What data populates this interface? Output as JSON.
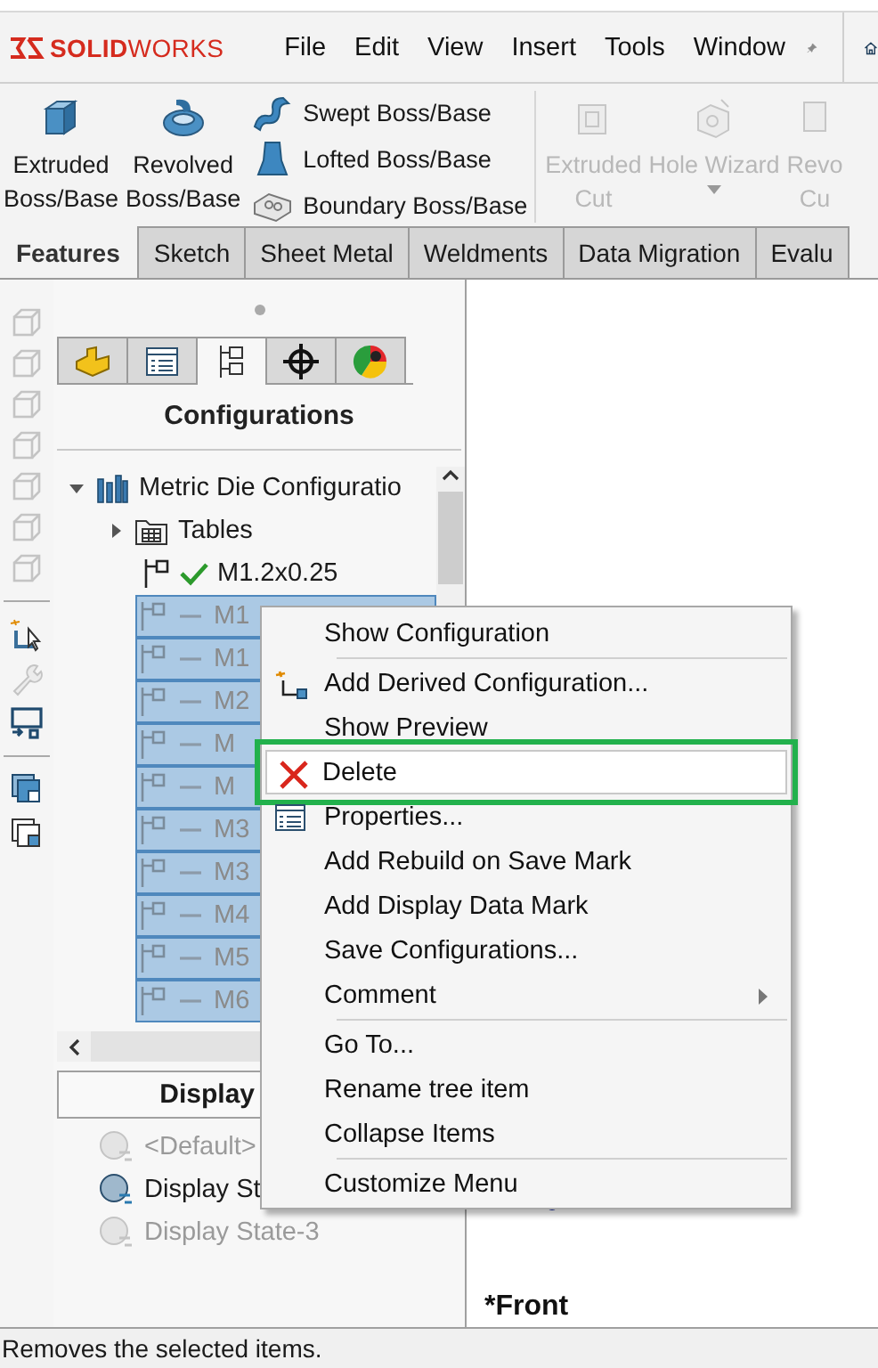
{
  "app_bar": {
    "logo": "**SOLID**WORKS",
    "menus": [
      {
        "label": "File"
      },
      {
        "label": "Edit"
      },
      {
        "label": "View"
      },
      {
        "label": "Insert"
      },
      {
        "label": "Tools"
      },
      {
        "label": "Window"
      }
    ]
  },
  "toolbar": {
    "commands": [
      {
        "kind": "large",
        "label": "Extruded\nBoss/Base",
        "disabled": false,
        "dropdown": false
      },
      {
        "kind": "large",
        "label": "Revolved\nBoss/Base",
        "disabled": false,
        "dropdown": false
      },
      {
        "kind": "stack",
        "items": [
          {
            "label": "Swept Boss/Base"
          },
          {
            "label": "Lofted Boss/Base"
          },
          {
            "label": "Boundary Boss/Base"
          }
        ]
      },
      {
        "kind": "separator"
      },
      {
        "kind": "large",
        "label": "Extruded\nCut",
        "disabled": true,
        "dropdown": false
      },
      {
        "kind": "large",
        "label": "Hole Wizard",
        "disabled": true,
        "dropdown": true
      },
      {
        "kind": "large",
        "label": "Revo\nCu",
        "disabled": true,
        "dropdown": false
      }
    ]
  },
  "command_tabs": [
    {
      "label": "Features",
      "selected": true
    },
    {
      "label": "Sketch",
      "selected": false
    },
    {
      "label": "Sheet Metal",
      "selected": false
    },
    {
      "label": "Weldments",
      "selected": false
    },
    {
      "label": "Data Migration",
      "selected": false
    },
    {
      "label": "Evalu",
      "selected": false
    }
  ],
  "panel": {
    "tabs": [
      {
        "selected": false
      },
      {
        "selected": false
      },
      {
        "selected": true
      },
      {
        "selected": false
      },
      {
        "selected": false
      }
    ],
    "title": "Configurations",
    "tree": [
      {
        "kind": "root",
        "label": "Metric Die Configuratio",
        "expanded": true,
        "children": [
          {
            "kind": "folder",
            "label": "Tables",
            "expanded": false
          },
          {
            "kind": "config",
            "label": "M1.2x0.25",
            "active": true,
            "selected": false
          },
          {
            "kind": "config",
            "label": "M1",
            "active": false,
            "selected": true
          },
          {
            "kind": "config",
            "label": "M1",
            "active": false,
            "selected": true
          },
          {
            "kind": "config",
            "label": "M2",
            "active": false,
            "selected": true
          },
          {
            "kind": "config",
            "label": "M",
            "active": false,
            "selected": true
          },
          {
            "kind": "config",
            "label": "M",
            "active": false,
            "selected": true
          },
          {
            "kind": "config",
            "label": "M3",
            "active": false,
            "selected": true
          },
          {
            "kind": "config",
            "label": "M3",
            "active": false,
            "selected": true
          },
          {
            "kind": "config",
            "label": "M4",
            "active": false,
            "selected": true
          },
          {
            "kind": "config",
            "label": "M5",
            "active": false,
            "selected": true
          },
          {
            "kind": "config",
            "label": "M6",
            "active": false,
            "selected": true
          }
        ]
      }
    ],
    "display_states": {
      "title": "Display",
      "items": [
        {
          "label": "<Default>",
          "dimmed": true
        },
        {
          "label": "Display St",
          "dimmed": false
        },
        {
          "label": "Display State-3",
          "dimmed": true
        }
      ]
    }
  },
  "context_menu": {
    "groups": [
      [
        {
          "label": "Show Configuration",
          "selected": false,
          "submenu": false
        }
      ],
      [
        {
          "label": "Add Derived Configuration...",
          "selected": false,
          "submenu": false
        },
        {
          "label": "Show Preview",
          "selected": false,
          "submenu": false
        },
        {
          "label": "Delete",
          "selected": true,
          "submenu": false
        },
        {
          "label": "Properties...",
          "selected": false,
          "submenu": false
        },
        {
          "label": "Add Rebuild on Save Mark",
          "selected": false,
          "submenu": false
        },
        {
          "label": "Add Display Data Mark",
          "selected": false,
          "submenu": false
        },
        {
          "label": "Save Configurations...",
          "selected": false,
          "submenu": false
        },
        {
          "label": "Comment",
          "selected": false,
          "submenu": true
        }
      ],
      [
        {
          "label": "Go To...",
          "selected": false,
          "submenu": false
        },
        {
          "label": "Rename tree item",
          "selected": false,
          "submenu": false
        },
        {
          "label": "Collapse Items",
          "selected": false,
          "submenu": false
        }
      ],
      [
        {
          "label": "Customize Menu",
          "selected": false,
          "submenu": false
        }
      ]
    ]
  },
  "graphics": {
    "view_label": "*Front"
  },
  "status_bar": {
    "text": "Removes the selected items."
  }
}
